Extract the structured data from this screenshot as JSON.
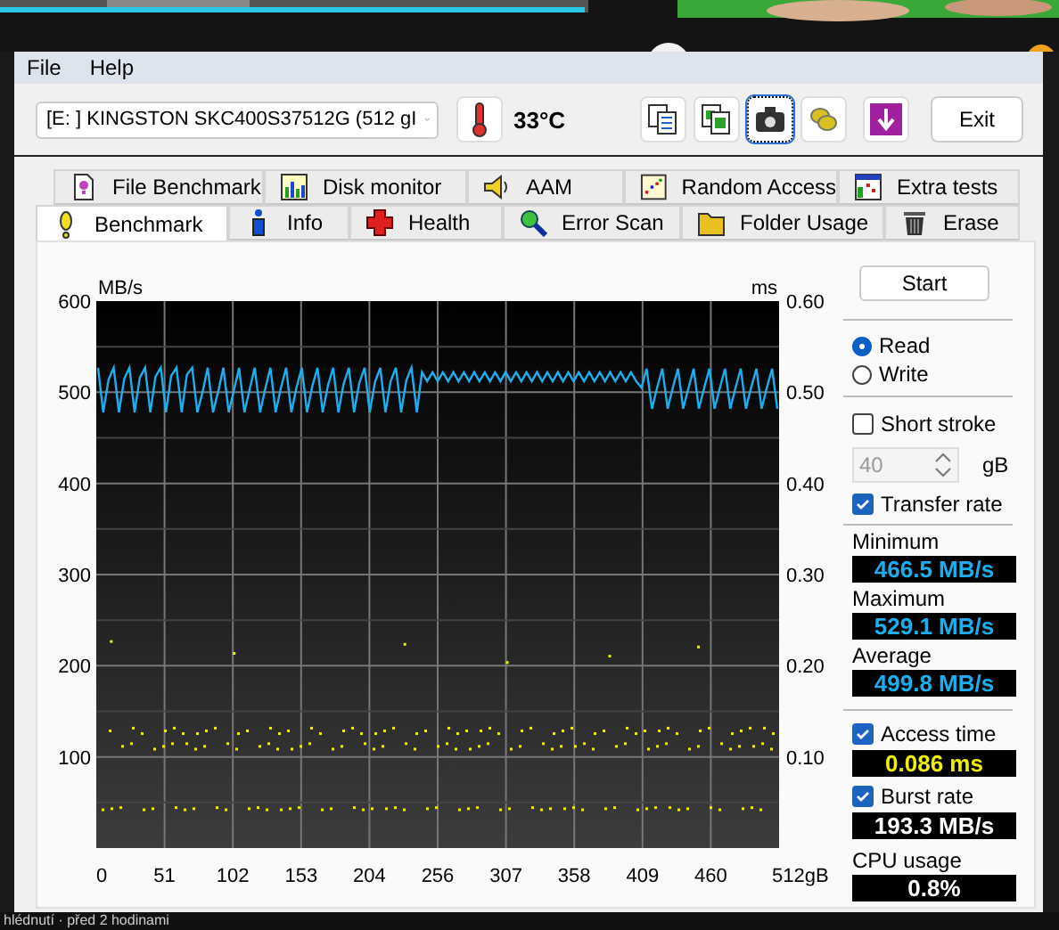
{
  "background": {
    "caption": "hlédnutí · před 2 hodinami"
  },
  "menu": [
    {
      "label": "File"
    },
    {
      "label": "Help"
    }
  ],
  "toolbar": {
    "drive": "[E: ] KINGSTON SKC400S37512G (512 gI",
    "temperature": "33°C",
    "tools": [
      {
        "kind": "copy-text",
        "selected": false
      },
      {
        "kind": "copy-image",
        "selected": false
      },
      {
        "kind": "camera",
        "selected": true
      },
      {
        "kind": "options",
        "selected": false
      },
      {
        "kind": "save",
        "selected": false
      }
    ],
    "exit": "Exit"
  },
  "tabs_back": [
    {
      "label": "File Benchmark",
      "kind": "file"
    },
    {
      "label": "Disk monitor",
      "kind": "monitor"
    },
    {
      "label": "AAM",
      "kind": "speaker"
    },
    {
      "label": "Random Access",
      "kind": "random"
    },
    {
      "label": "Extra tests",
      "kind": "extra"
    }
  ],
  "tabs_front": [
    {
      "label": "Benchmark",
      "kind": "bench",
      "selected": true
    },
    {
      "label": "Info",
      "kind": "info",
      "selected": false
    },
    {
      "label": "Health",
      "kind": "health",
      "selected": false
    },
    {
      "label": "Error Scan",
      "kind": "scan",
      "selected": false
    },
    {
      "label": "Folder Usage",
      "kind": "folder",
      "selected": false
    },
    {
      "label": "Erase",
      "kind": "erase",
      "selected": false
    }
  ],
  "benchmark": {
    "graph": {
      "left_axis": {
        "title": "MB/s",
        "ticks": [
          "600",
          "500",
          "400",
          "300",
          "200",
          "100"
        ]
      },
      "right_axis": {
        "title": "ms",
        "ticks": [
          "0.60",
          "0.50",
          "0.40",
          "0.30",
          "0.20",
          "0.10"
        ]
      },
      "bottom_axis": {
        "ticks": [
          "0",
          "51",
          "102",
          "153",
          "204",
          "256",
          "307",
          "358",
          "409",
          "460",
          "512gB"
        ]
      }
    },
    "start": "Start",
    "mode": [
      {
        "label": "Read",
        "selected": true
      },
      {
        "label": "Write",
        "selected": false
      }
    ],
    "short_stroke": {
      "label": "Short stroke",
      "checked": false
    },
    "stroke_size": {
      "value": "40",
      "unit": "gB",
      "disabled": true
    },
    "transfer_rate": {
      "label": "Transfer rate",
      "checked": true
    },
    "stats": [
      {
        "label": "Minimum",
        "value": "466.5 MB/s"
      },
      {
        "label": "Maximum",
        "value": "529.1 MB/s"
      },
      {
        "label": "Average",
        "value": "499.8 MB/s"
      }
    ],
    "extras": [
      {
        "kind": "time",
        "label": "Access time",
        "checked": true,
        "value": "0.086 ms"
      },
      {
        "kind": "burst",
        "label": "Burst rate",
        "checked": true,
        "value": "193.3 MB/s"
      },
      {
        "kind": "cpu",
        "label": "CPU usage",
        "value": "0.8%"
      }
    ]
  }
}
